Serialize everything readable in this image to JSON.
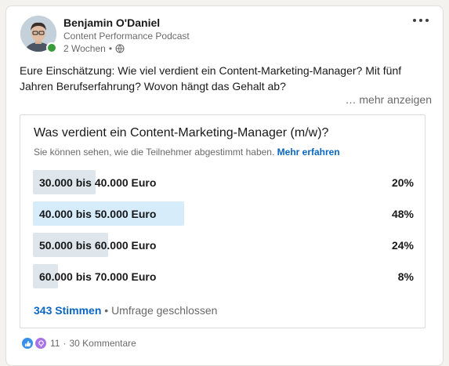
{
  "author": {
    "name": "Benjamin O'Daniel",
    "subtitle": "Content Performance Podcast",
    "time": "2 Wochen"
  },
  "post": {
    "text": "Eure Einschätzung: Wie viel verdient ein Content-Marketing-Manager? Mit fünf Jahren Berufserfahrung? Wovon hängt das Gehalt ab?",
    "see_more": "… mehr anzeigen",
    "more_icon": "more-horizontal-icon"
  },
  "poll": {
    "question": "Was verdient ein Content-Marketing-Manager (m/w)?",
    "visibility_note": "Sie können sehen, wie die Teilnehmer abgestimmt haben.",
    "learn_more": "Mehr erfahren",
    "options": [
      {
        "label": "30.000 bis 40.000 Euro",
        "percent": "20%",
        "share": 0.2,
        "selected": false
      },
      {
        "label": "40.000 bis 50.000 Euro",
        "percent": "48%",
        "share": 0.48,
        "selected": true
      },
      {
        "label": "50.000 bis 60.000 Euro",
        "percent": "24%",
        "share": 0.24,
        "selected": false
      },
      {
        "label": "60.000 bis 70.000 Euro",
        "percent": "8%",
        "share": 0.08,
        "selected": false
      }
    ],
    "votes": "343 Stimmen",
    "status": "Umfrage geschlossen",
    "bar_color": "#dee6ec",
    "selected_bar_color": "#d7ecfa"
  },
  "social": {
    "reaction_count": "11",
    "comments": "30 Kommentare"
  }
}
